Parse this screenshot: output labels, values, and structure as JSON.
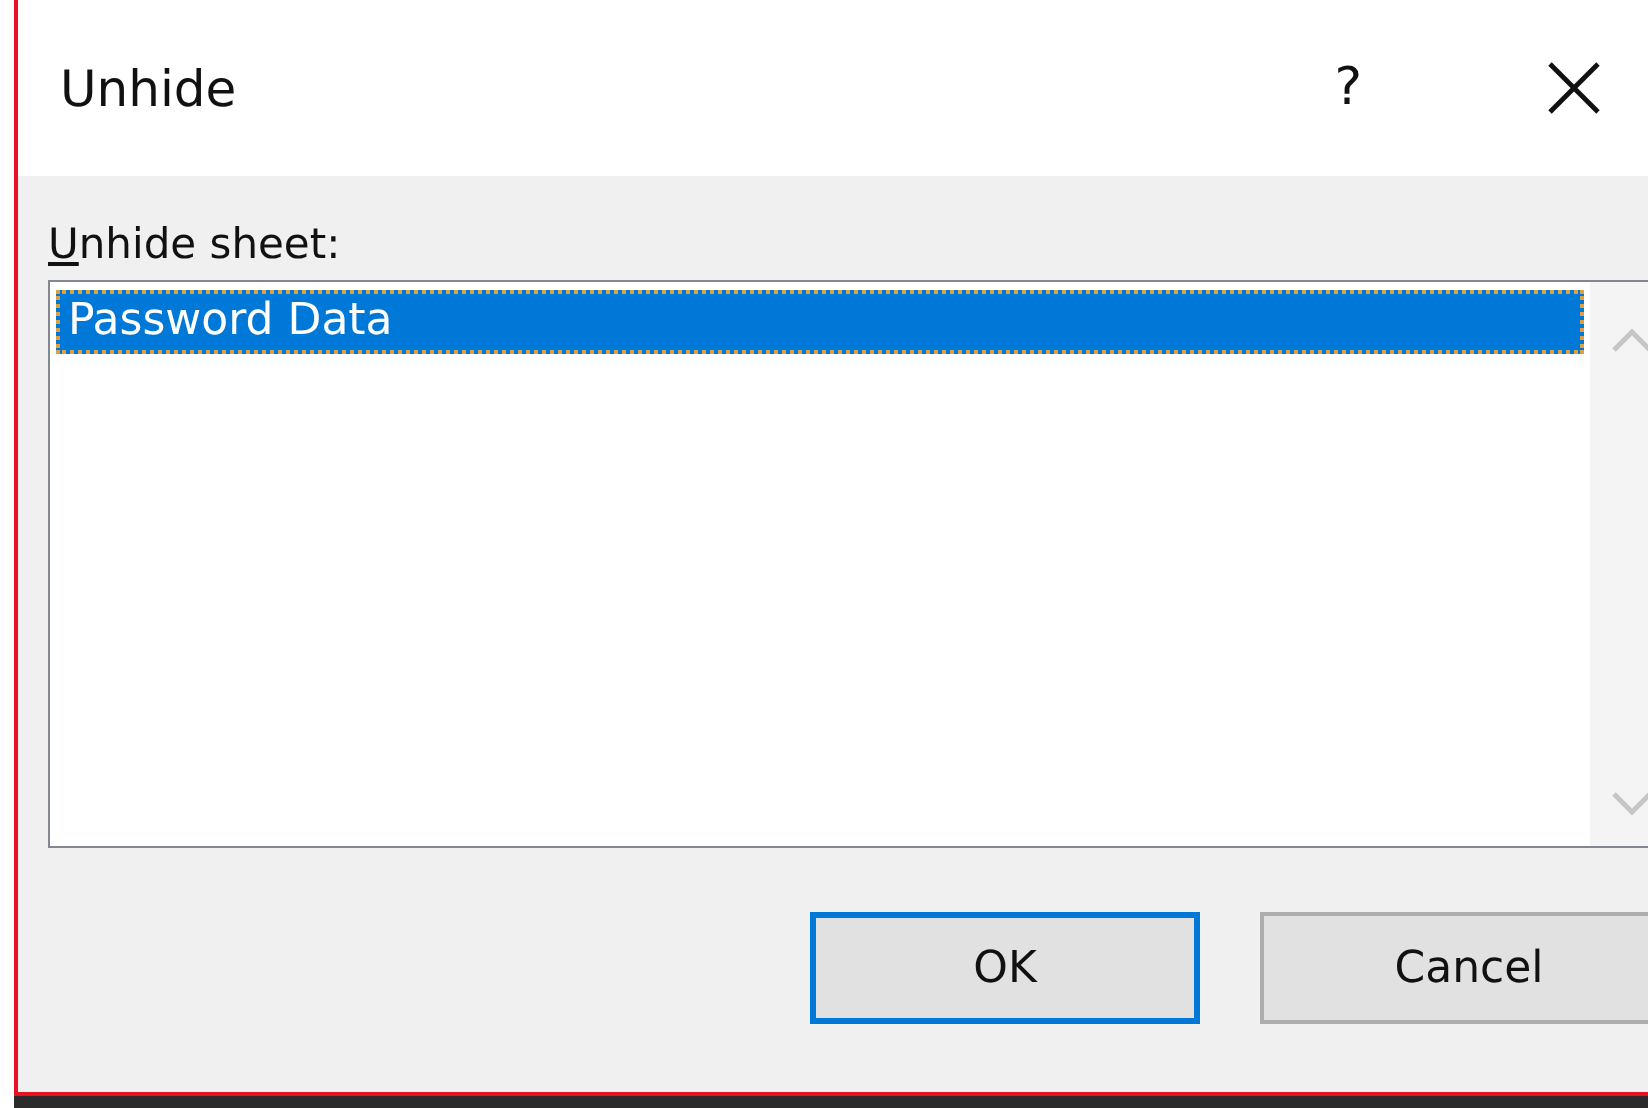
{
  "window": {
    "title": "Unhide",
    "help": "?"
  },
  "label": "Unhide sheet:",
  "sheets": [
    {
      "name": "Password Data",
      "selected": true
    }
  ],
  "buttons": [
    {
      "label": "OK",
      "default": true
    },
    {
      "label": "Cancel",
      "default": false
    }
  ]
}
